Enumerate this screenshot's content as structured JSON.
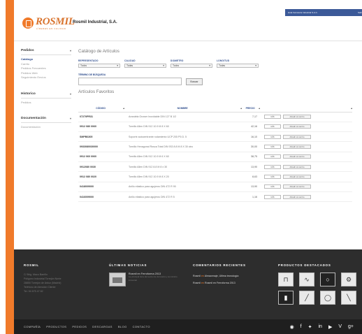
{
  "header": {
    "logo_text": "ROSMIL",
    "logo_sub": "LÍDERES EN CALIDAD",
    "company_name": "Rosmil Industrial, S.A.",
    "user_label": "Hola Ferretería Industrial S.A.C.",
    "user_action": "Salir"
  },
  "sidebar": {
    "groups": [
      {
        "title": "Pedidos",
        "items": [
          "Catálogo",
          "Carrito",
          "Pedidos Frecuentes",
          "Pedidos Web",
          "Seguimiento Envíos"
        ]
      },
      {
        "title": "Historico",
        "items": [
          "Pedidos"
        ]
      },
      {
        "title": "Documentación",
        "items": [
          "Documentación"
        ]
      }
    ]
  },
  "catalog": {
    "title": "Catálogo de Artículos",
    "filters": [
      {
        "label": "REPRESENTADO",
        "value": "Todos"
      },
      {
        "label": "CALIDAD",
        "value": "Todas"
      },
      {
        "label": "DIÁMETRO",
        "value": "Todos"
      },
      {
        "label": "LONGITUD",
        "value": "Todas"
      }
    ],
    "search_label": "TÉRMINO DE BÚSQUEDA",
    "search_value": "",
    "search_button": "Buscar",
    "favorites_title": "Artículos Favoritos",
    "columns": [
      "CÓDIGO",
      "NOMBRE",
      "PRECIO",
      ""
    ],
    "rows": [
      {
        "code": "07270PR31",
        "name": "Arandela Grower Inoxidable DIN 127 B 1/2",
        "price": "7,17",
        "qty": "uds"
      },
      {
        "code": "0912 080 0060",
        "name": "Tornillo Allen DIN 912 10.9 M 8 X 60",
        "price": "42,16",
        "qty": "uds"
      },
      {
        "code": "SMPB6305",
        "name": "Soporte autocentrante rodamiento UCP 205 P5 D. 5",
        "price": "16,10",
        "qty": "uds"
      },
      {
        "code": "0933080030000",
        "name": "Tornillo Hexagonal Rosca Total DIN 933 8.8 M 8 X 30 cinc",
        "price": "30,00",
        "qty": "uds"
      },
      {
        "code": "0912 060 0060",
        "name": "Tornillo Allen DIN 912 10.9 M 6 X 60",
        "price": "38,75",
        "qty": "uds"
      },
      {
        "code": "0912080 0030",
        "name": "Tornillo Allen DIN 912 8.8 M 8 x 30",
        "price": "13,90",
        "qty": "uds"
      },
      {
        "code": "0912 080 0020",
        "name": "Tornillo Allen DIN 912 10.9 M 8 X 20",
        "price": "8,63",
        "qty": "uds"
      },
      {
        "code": "0418009000",
        "name": "Anillo elástico para agujeros DIN 472 R 90",
        "price": "13,90",
        "qty": "uds"
      },
      {
        "code": "0416009000",
        "name": "Anillo elástico para agujeros DIN 472 R 5",
        "price": "1,16",
        "qty": "uds"
      }
    ],
    "add_label": "Añadir al carrito"
  },
  "footer": {
    "col1": {
      "title": "ROSMIL",
      "lines": [
        "C/ Brig. Maco Barrillo",
        "Polígono Industrial Torrejón Norte",
        "28850 Torrejón de Ardoz (Madrid)",
        "Teléfono de Atención Cliente",
        "Tel. 94 675 47 82"
      ]
    },
    "col2": {
      "title": "ÚLTIMAS NOTICIAS",
      "news_title": "Rosmil en Ferroforma 2013",
      "news_sub": "La principal feria del sector de ferretería y suministro industrial"
    },
    "col3": {
      "title": "COMENTARIOS RECIENTES",
      "lines": [
        {
          "who": "Rosmil",
          "text": "Almacenaje, Ultima tecnología"
        },
        {
          "who": "Rosmil",
          "text": "Rosmil en Ferroforma 2013"
        }
      ]
    },
    "col4": {
      "title": "PRODUCTOS DESTACADOS"
    },
    "nav": [
      "COMPAÑÍA",
      "PRODUCTOS",
      "PEDIDOS",
      "DESCARGAS",
      "BLOG",
      "CONTACTO"
    ]
  },
  "colors": {
    "accent": "#f07a2a",
    "brand_blue": "#2c4b8c",
    "footer_bg": "#2d2d2d"
  }
}
